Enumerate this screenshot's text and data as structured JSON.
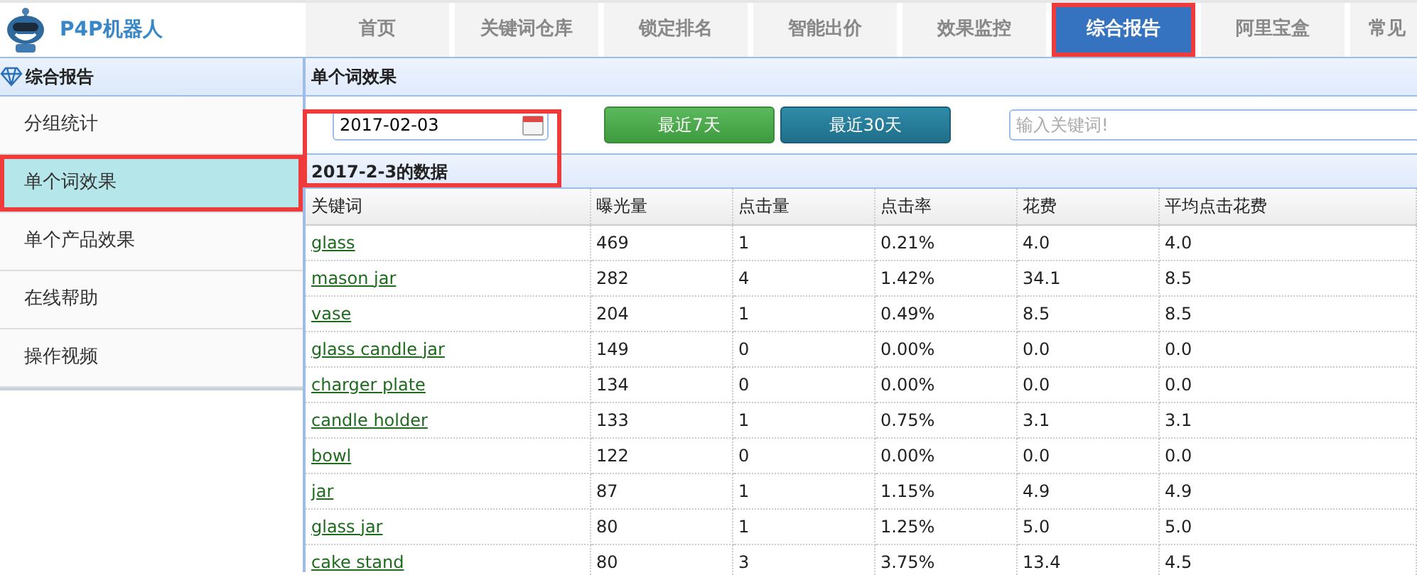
{
  "app": {
    "title": "P4P机器人"
  },
  "tabs": [
    {
      "label": "首页",
      "selected": false,
      "highlighted": false
    },
    {
      "label": "关键词仓库",
      "selected": false,
      "highlighted": false
    },
    {
      "label": "锁定排名",
      "selected": false,
      "highlighted": false
    },
    {
      "label": "智能出价",
      "selected": false,
      "highlighted": false
    },
    {
      "label": "效果监控",
      "selected": false,
      "highlighted": false
    },
    {
      "label": "综合报告",
      "selected": true,
      "highlighted": true
    },
    {
      "label": "阿里宝盒",
      "selected": false,
      "highlighted": false
    },
    {
      "label": "常见",
      "selected": false,
      "highlighted": false
    }
  ],
  "sidebar": {
    "title": "综合报告",
    "items": [
      {
        "label": "分组统计",
        "selected": false,
        "highlighted": false
      },
      {
        "label": "单个词效果",
        "selected": true,
        "highlighted": true
      },
      {
        "label": "单个产品效果",
        "selected": false,
        "highlighted": false
      },
      {
        "label": "在线帮助",
        "selected": false,
        "highlighted": false
      },
      {
        "label": "操作视频",
        "selected": false,
        "highlighted": false
      }
    ]
  },
  "panel": {
    "title": "单个词效果",
    "date": "2017-02-03",
    "date_highlighted": true,
    "buttons": [
      {
        "label": "最近7天",
        "kind": "green"
      },
      {
        "label": "最近30天",
        "kind": "teal"
      }
    ],
    "search": {
      "placeholder": "输入关键词!"
    },
    "subtitle": "2017-2-3的数据"
  },
  "table": {
    "columns": [
      "关键词",
      "曝光量",
      "点击量",
      "点击率",
      "花费",
      "平均点击花费"
    ],
    "rows": [
      [
        "glass",
        "469",
        "1",
        "0.21%",
        "4.0",
        "4.0"
      ],
      [
        "mason jar",
        "282",
        "4",
        "1.42%",
        "34.1",
        "8.5"
      ],
      [
        "vase",
        "204",
        "1",
        "0.49%",
        "8.5",
        "8.5"
      ],
      [
        "glass candle jar",
        "149",
        "0",
        "0.00%",
        "0.0",
        "0.0"
      ],
      [
        "charger plate",
        "134",
        "0",
        "0.00%",
        "0.0",
        "0.0"
      ],
      [
        "candle holder",
        "133",
        "1",
        "0.75%",
        "3.1",
        "3.1"
      ],
      [
        "bowl",
        "122",
        "0",
        "0.00%",
        "0.0",
        "0.0"
      ],
      [
        "jar",
        "87",
        "1",
        "1.15%",
        "4.9",
        "4.9"
      ],
      [
        "glass jar",
        "80",
        "1",
        "1.25%",
        "5.0",
        "5.0"
      ],
      [
        "cake stand",
        "80",
        "3",
        "3.75%",
        "13.4",
        "4.5"
      ]
    ]
  }
}
